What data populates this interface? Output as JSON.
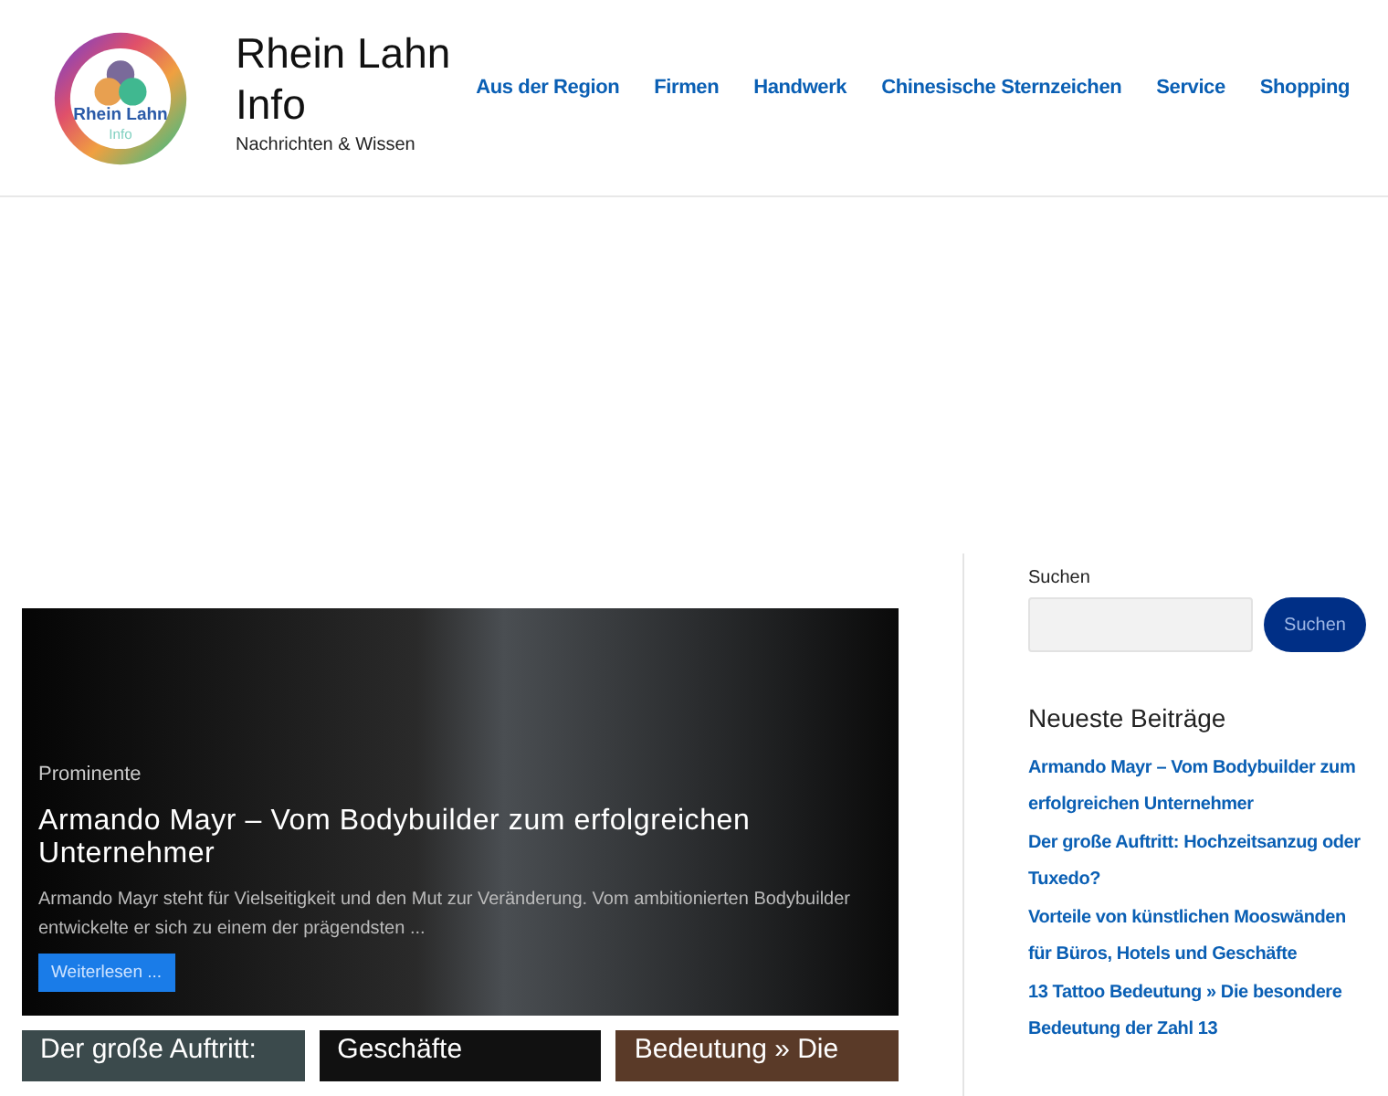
{
  "header": {
    "logo": {
      "line_1": "Rhein Lahn",
      "line_2": "Info"
    },
    "site_title": "Rhein Lahn Info",
    "tagline": "Nachrichten & Wissen",
    "nav": [
      "Aus der Region",
      "Firmen",
      "Handwerk",
      "Chinesische Sternzeichen",
      "Service",
      "Shopping"
    ]
  },
  "hero": {
    "category": "Prominente",
    "title": "Armando Mayr – Vom Bodybuilder zum erfolgreichen Unternehmer",
    "excerpt": "Armando Mayr steht für Vielseitigkeit und den Mut zur Veränderung. Vom ambitionierten Bodybuilder entwickelte er sich zu einem der prägendsten ...",
    "button": "Weiterlesen ..."
  },
  "cards": [
    {
      "title": "Der große Auftritt:",
      "color": "#3b4a4c"
    },
    {
      "title": "Geschäfte",
      "color": "#111111"
    },
    {
      "title": "Bedeutung » Die",
      "color": "#5a3a28"
    }
  ],
  "sidebar": {
    "search_label": "Suchen",
    "search_button": "Suchen",
    "recent_heading": "Neueste Beiträge",
    "recent": [
      "Armando Mayr – Vom Bodybuilder zum erfolgreichen Unternehmer",
      "Der große Auftritt: Hochzeitsanzug oder Tuxedo?",
      "Vorteile von künstlichen Mooswänden für Büros, Hotels und Geschäfte",
      "13 Tattoo Bedeutung » Die besondere Bedeutung der Zahl 13"
    ]
  }
}
